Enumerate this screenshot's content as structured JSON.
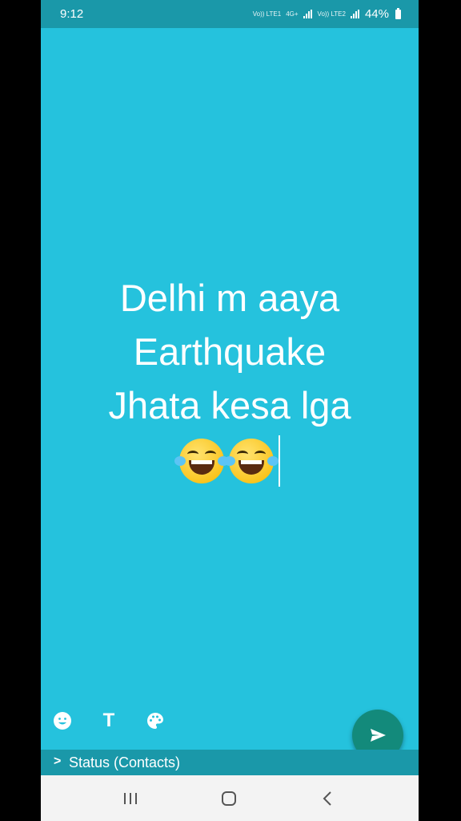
{
  "status_bar": {
    "time": "9:12",
    "network1": "Vo)) LTE1",
    "network_type": "4G+",
    "network2": "Vo)) LTE2",
    "battery": "44%"
  },
  "status_post": {
    "background_color": "#25c2dd",
    "lines": [
      "Delhi m aaya",
      "Earthquake",
      "Jhata kesa lga"
    ],
    "emojis": [
      "face-with-tears-of-joy",
      "face-with-tears-of-joy"
    ]
  },
  "toolbar": {
    "emoji_icon": "smiley-icon",
    "text_icon": "T",
    "color_icon": "palette-icon"
  },
  "send": {
    "icon": "send-arrow-icon"
  },
  "audience": {
    "chevron": ">",
    "label": "Status (Contacts)"
  },
  "nav": {
    "recent": "recent-apps-icon",
    "home": "home-icon",
    "back": "back-icon"
  }
}
